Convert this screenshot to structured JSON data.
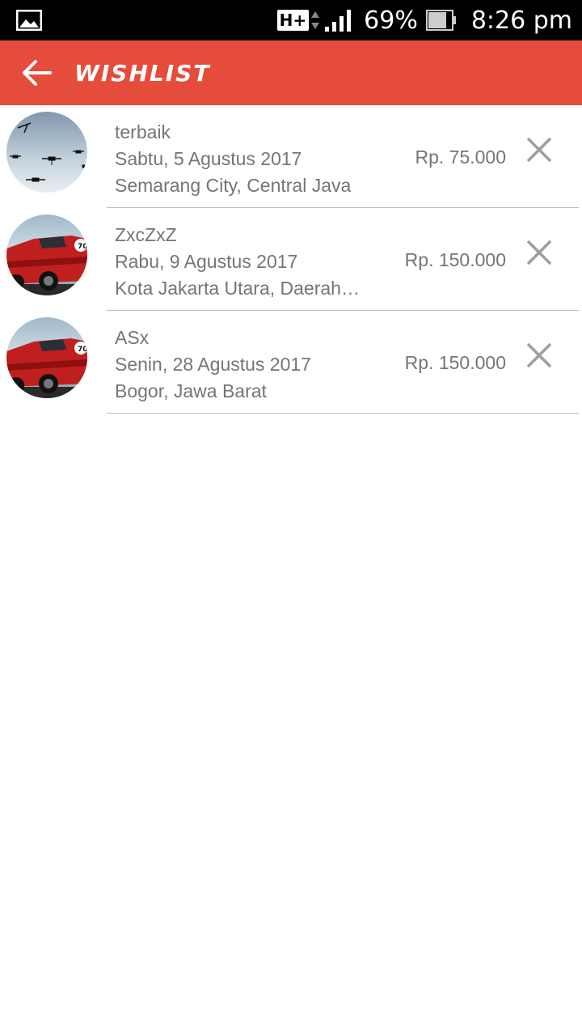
{
  "status_bar": {
    "network": "H+",
    "battery_percent": "69%",
    "time": "8:26 pm",
    "icons": [
      "gallery-icon",
      "data-arrows-icon",
      "signal-icon",
      "battery-icon"
    ]
  },
  "app_bar": {
    "title": "WISHLIST",
    "back_icon": "arrow-left-icon",
    "color": "#e64c3b"
  },
  "wishlist": {
    "items": [
      {
        "title": "terbaik",
        "date": "Sabtu, 5 Agustus 2017",
        "location": "Semarang City, Central Java",
        "price": "Rp. 75.000",
        "image": "drones"
      },
      {
        "title": "ZxcZxZ",
        "date": "Rabu, 9 Agustus 2017",
        "location": "Kota Jakarta Utara, Daerah…",
        "price": "Rp. 150.000",
        "image": "red-car"
      },
      {
        "title": "ASx",
        "date": "Senin, 28 Agustus 2017",
        "location": "Bogor, Jawa Barat",
        "price": "Rp. 150.000",
        "image": "red-car"
      }
    ]
  }
}
